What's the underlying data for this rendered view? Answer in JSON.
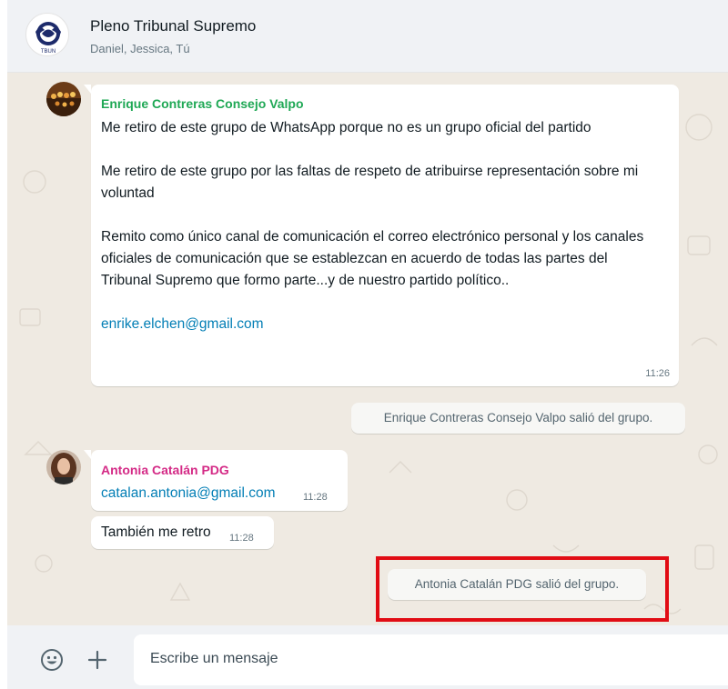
{
  "header": {
    "title": "Pleno Tribunal Supremo",
    "members": "Daniel, Jessica, Tú",
    "avatar_icon": "group-emblem-icon"
  },
  "messages": [
    {
      "sender": "Enrique Contreras Consejo Valpo",
      "sender_color": "#1fa855",
      "paragraphs": [
        "Me retiro de este grupo de WhatsApp porque no es un grupo oficial del partido",
        "Me retiro de este grupo por las faltas de respeto de atribuirse representación sobre mi voluntad",
        "Remito como único canal de comunicación el correo electrónico personal y los canales oficiales de comunicación que se establezcan en acuerdo de todas las partes  del Tribunal Supremo que formo parte...y de nuestro partido político.."
      ],
      "link": "enrike.elchen@gmail.com",
      "time": "11:26"
    },
    {
      "sender": "Antonia Catalán PDG",
      "sender_color": "#d42a86",
      "link": "catalan.antonia@gmail.com",
      "time": "11:28"
    },
    {
      "text": "También me retro",
      "time": "11:28"
    }
  ],
  "system_messages": [
    "Enrique Contreras Consejo Valpo salió del grupo.",
    "Antonia Catalán PDG salió del grupo."
  ],
  "highlight_color": "#e10c14",
  "composer": {
    "placeholder": "Escribe un mensaje",
    "emoji_icon": "emoji-icon",
    "attach_icon": "plus-icon"
  }
}
